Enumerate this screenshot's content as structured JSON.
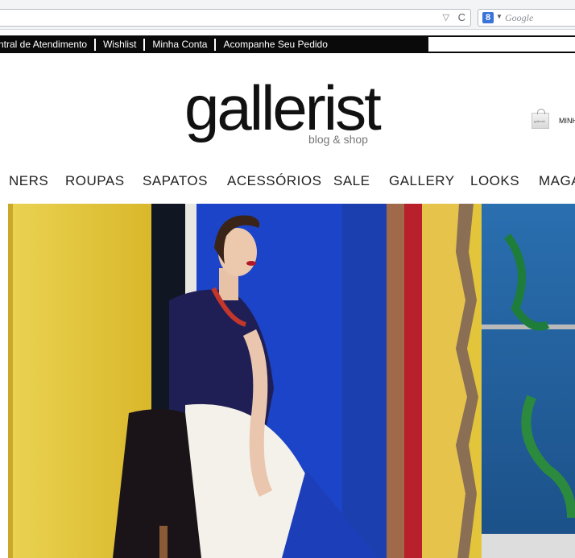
{
  "browser": {
    "search_engine_placeholder": "Google",
    "search_engine_badge": "8"
  },
  "topbar": {
    "links": [
      "ntral de Atendimento",
      "Wishlist",
      "Minha Conta",
      "Acompanhe Seu Pedido"
    ]
  },
  "logo": {
    "word": "gallerist",
    "tagline": "blog & shop"
  },
  "cart": {
    "label": "MINH",
    "bag_text": "gallerist"
  },
  "nav": {
    "items": [
      "NERS",
      "ROUPAS",
      "SAPATOS",
      "ACESSÓRIOS",
      "SALE",
      "GALLERY",
      "LOOKS",
      "MAGA"
    ]
  },
  "colors": {
    "topbar_bg": "#0a0a0a",
    "hero_yellow": "#e3c53c",
    "hero_blue": "#1c44c8"
  }
}
